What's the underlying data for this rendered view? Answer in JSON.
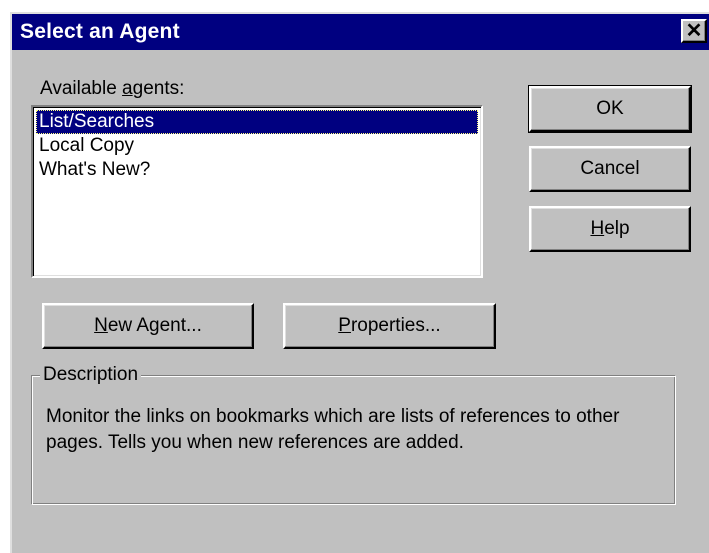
{
  "window": {
    "title": "Select an Agent",
    "close_glyph": "✕"
  },
  "agents": {
    "label_prefix": "Available ",
    "label_accel": "a",
    "label_suffix": "gents:",
    "items": [
      "List/Searches",
      "Local Copy",
      "What's New?"
    ],
    "selected_index": 0
  },
  "buttons": {
    "ok": "OK",
    "cancel": "Cancel",
    "help_accel": "H",
    "help_rest": "elp",
    "new_agent_accel": "N",
    "new_agent_rest": "ew Agent...",
    "properties_accel": "P",
    "properties_rest": "roperties..."
  },
  "description": {
    "label": "Description",
    "text": "Monitor the links on bookmarks which are lists of references to other pages.  Tells you when new references are added."
  },
  "colors": {
    "face": "#c0c0c0",
    "titlebar": "#000080",
    "selection": "#000080"
  }
}
